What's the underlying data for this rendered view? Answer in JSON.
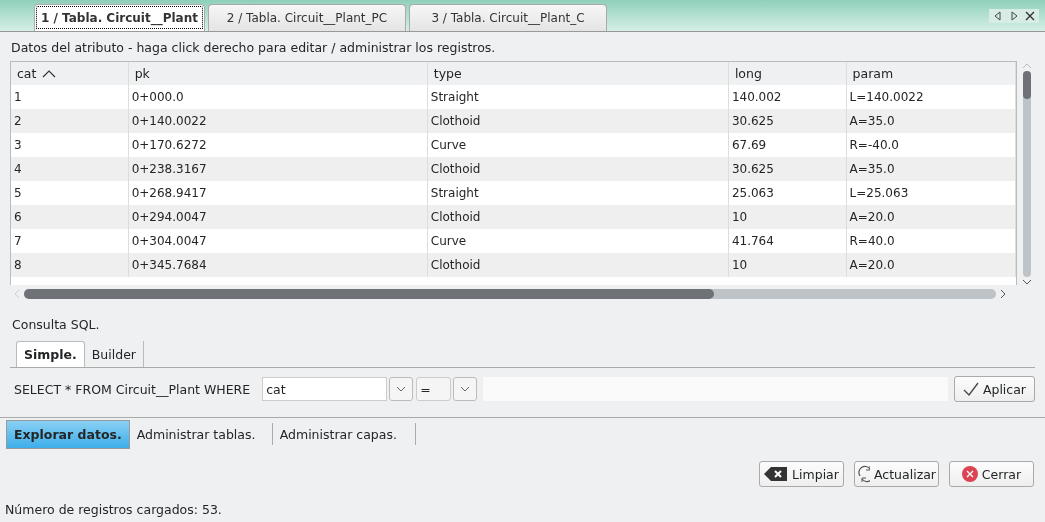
{
  "doc_tabs": [
    {
      "label": "1 / Tabla. Circuit__Plant",
      "selected": true
    },
    {
      "label": "2 / Tabla. Circuit__Plant_PC",
      "selected": false
    },
    {
      "label": "3 / Tabla. Circuit__Plant_C",
      "selected": false
    }
  ],
  "hint": "Datos del atributo - haga click derecho para editar / administrar los registros.",
  "table": {
    "columns": [
      {
        "label": "cat",
        "sorted": true
      },
      {
        "label": "pk",
        "sorted": false
      },
      {
        "label": "type",
        "sorted": false
      },
      {
        "label": "long",
        "sorted": false
      },
      {
        "label": "param",
        "sorted": false
      }
    ],
    "rows": [
      [
        "1",
        "0+000.0",
        "Straight",
        "140.002",
        "L=140.0022"
      ],
      [
        "2",
        "0+140.0022",
        "Clothoid",
        "30.625",
        "A=35.0"
      ],
      [
        "3",
        "0+170.6272",
        "Curve",
        "67.69",
        "R=-40.0"
      ],
      [
        "4",
        "0+238.3167",
        "Clothoid",
        "30.625",
        "A=35.0"
      ],
      [
        "5",
        "0+268.9417",
        "Straight",
        "25.063",
        "L=25.063"
      ],
      [
        "6",
        "0+294.0047",
        "Clothoid",
        "10",
        "A=20.0"
      ],
      [
        "7",
        "0+304.0047",
        "Curve",
        "41.764",
        "R=40.0"
      ],
      [
        "8",
        "0+345.7684",
        "Clothoid",
        "10",
        "A=20.0"
      ]
    ]
  },
  "sql_label": "Consulta SQL.",
  "sql_tabs": [
    {
      "label": "Simple.",
      "selected": true
    },
    {
      "label": "Builder",
      "selected": false
    }
  ],
  "query": {
    "prefix": "SELECT * FROM Circuit__Plant WHERE",
    "field": "cat",
    "operator": "=",
    "apply": "Aplicar"
  },
  "main_tabs": [
    {
      "label": "Explorar datos.",
      "selected": true
    },
    {
      "label": "Administrar tablas.",
      "selected": false
    },
    {
      "label": "Administrar capas.",
      "selected": false
    }
  ],
  "buttons": [
    {
      "kind": "clear",
      "label": "Limpiar"
    },
    {
      "kind": "refresh",
      "label": "Actualizar"
    },
    {
      "kind": "close",
      "label": "Cerrar"
    }
  ],
  "status": "Número de registros cargados: 53."
}
